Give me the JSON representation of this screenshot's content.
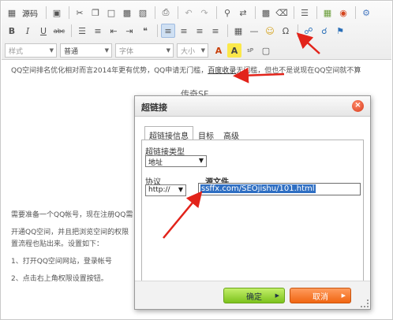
{
  "toolbar": {
    "source_label": "源码",
    "style_combo": "样式",
    "format_combo": "普通",
    "font_combo": "字体",
    "size_combo": "大小"
  },
  "content": {
    "line1_prefix": "QQ空间排名优化相对而言2014年更有优势，QQ申请无门槛，",
    "line1_link": "百度收录",
    "line1_suffix": "无门槛，但也不是说现在QQ空间就不算",
    "seo_text": "传奇SF",
    "line2": "需要准备一个QQ帐号，现在注册QQ需",
    "line3": "开通QQ空间，并且把浏览空间的权限",
    "line4": "置流程也贴出来。设置如下：",
    "item1_prefix": "1、打开",
    "item1_link": "QQ空间网站",
    "item1_suffix": "，登录帐号",
    "item2": "2、点击右上角权限设置按钮。"
  },
  "dialog": {
    "title": "超链接",
    "tabs": [
      "超链接信息",
      "目标",
      "高级"
    ],
    "link_type_label": "超链接类型",
    "link_type_value": "地址",
    "protocol_label": "协议",
    "protocol_value": "http://",
    "url_label": "源文件",
    "url_value": "ssffx.com/SEOjishu/101.html",
    "ok_label": "确定",
    "cancel_label": "取消"
  },
  "colors": {
    "ok_green": "#8ccd2c",
    "cancel_orange": "#f26e1a",
    "annotation_red": "#e2231a",
    "selection_blue": "#2f6fc3"
  }
}
